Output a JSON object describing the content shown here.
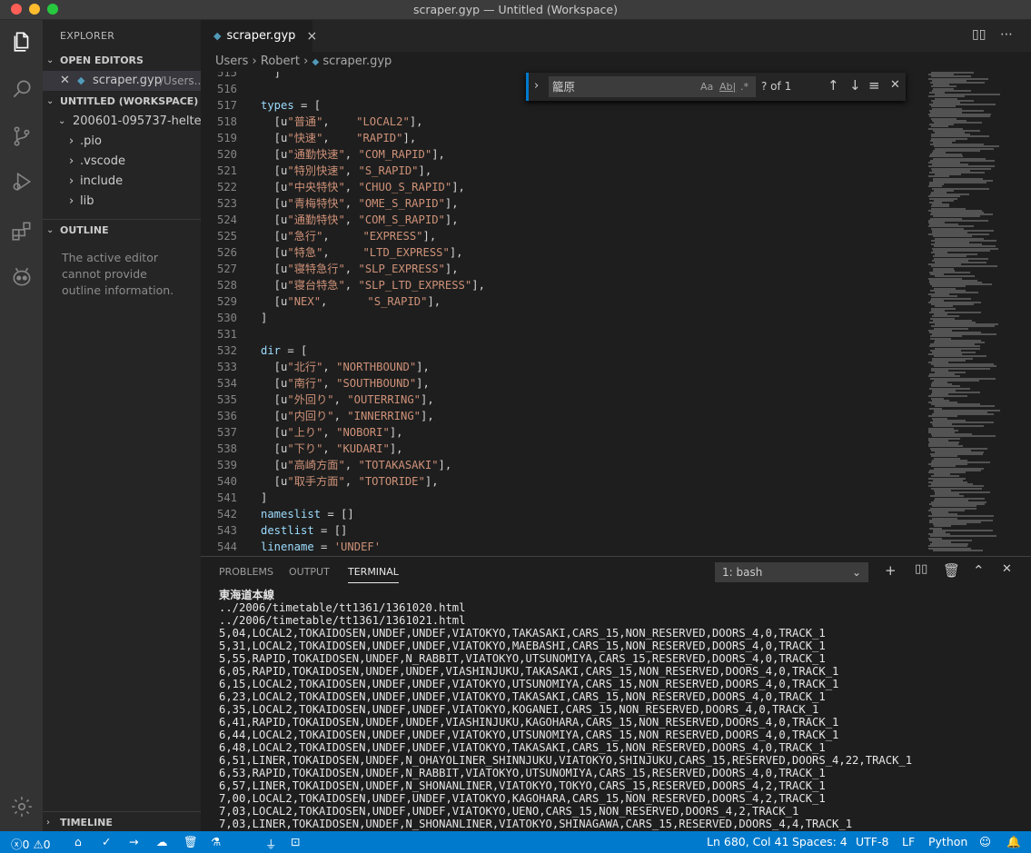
{
  "window": {
    "title": "scraper.gyp — Untitled (Workspace)",
    "traffic": {
      "close": "#ff5f56",
      "minimize": "#ffbd2e",
      "zoom": "#27c93f"
    }
  },
  "activity_bar": {
    "icons": [
      "files-icon",
      "search-icon",
      "source-control-icon",
      "run-debug-icon",
      "extensions-icon",
      "platformio-alien-icon",
      "settings-gear-icon"
    ]
  },
  "sidebar": {
    "title": "EXPLORER",
    "open_editors": {
      "header": "OPEN EDITORS",
      "file_name": "scraper.gyp",
      "file_path": "/Users..."
    },
    "workspace": {
      "header": "UNTITLED (WORKSPACE)",
      "root": "200601-095737-helte...",
      "folders": [
        ".pio",
        ".vscode",
        "include",
        "lib"
      ]
    },
    "outline": {
      "header": "OUTLINE",
      "message": "The active editor cannot provide outline information."
    },
    "timeline": {
      "header": "TIMELINE"
    }
  },
  "editor": {
    "tab": {
      "label": "scraper.gyp",
      "close": "×"
    },
    "breadcrumb": [
      "Users",
      "Robert",
      "scraper.gyp"
    ],
    "find": {
      "query": "籠原",
      "case": "Aa",
      "word": "Ab|",
      "regex": ".*",
      "result": "? of 1"
    },
    "lines": [
      {
        "n": "515",
        "t": "  ]"
      },
      {
        "n": "516",
        "t": ""
      },
      {
        "n": "517",
        "t": "types = ["
      },
      {
        "n": "518",
        "t": "  [u\"普通\",    \"LOCAL2\"],"
      },
      {
        "n": "519",
        "t": "  [u\"快速\",    \"RAPID\"],"
      },
      {
        "n": "520",
        "t": "  [u\"通勤快速\", \"COM_RAPID\"],"
      },
      {
        "n": "521",
        "t": "  [u\"特別快速\", \"S_RAPID\"],"
      },
      {
        "n": "522",
        "t": "  [u\"中央特快\", \"CHUO_S_RAPID\"],"
      },
      {
        "n": "523",
        "t": "  [u\"青梅特快\", \"OME_S_RAPID\"],"
      },
      {
        "n": "524",
        "t": "  [u\"通勤特快\", \"COM_S_RAPID\"],"
      },
      {
        "n": "525",
        "t": "  [u\"急行\",     \"EXPRESS\"],"
      },
      {
        "n": "526",
        "t": "  [u\"特急\",     \"LTD_EXPRESS\"],"
      },
      {
        "n": "527",
        "t": "  [u\"寝特急行\", \"SLP_EXPRESS\"],"
      },
      {
        "n": "528",
        "t": "  [u\"寝台特急\", \"SLP_LTD_EXPRESS\"],"
      },
      {
        "n": "529",
        "t": "  [u\"NEX\",      \"S_RAPID\"],"
      },
      {
        "n": "530",
        "t": "]"
      },
      {
        "n": "531",
        "t": ""
      },
      {
        "n": "532",
        "t": "dir = ["
      },
      {
        "n": "533",
        "t": "  [u\"北行\", \"NORTHBOUND\"],"
      },
      {
        "n": "534",
        "t": "  [u\"南行\", \"SOUTHBOUND\"],"
      },
      {
        "n": "535",
        "t": "  [u\"外回り\", \"OUTERRING\"],"
      },
      {
        "n": "536",
        "t": "  [u\"内回り\", \"INNERRING\"],"
      },
      {
        "n": "537",
        "t": "  [u\"上り\", \"NOBORI\"],"
      },
      {
        "n": "538",
        "t": "  [u\"下り\", \"KUDARI\"],"
      },
      {
        "n": "539",
        "t": "  [u\"高崎方面\", \"TOTAKASAKI\"],"
      },
      {
        "n": "540",
        "t": "  [u\"取手方面\", \"TOTORIDE\"],"
      },
      {
        "n": "541",
        "t": "]"
      },
      {
        "n": "542",
        "t": "nameslist = []"
      },
      {
        "n": "543",
        "t": "destlist = []"
      },
      {
        "n": "544",
        "t": "linename = 'UNDEF'"
      }
    ]
  },
  "panel": {
    "tabs": [
      "PROBLEMS",
      "OUTPUT",
      "TERMINAL"
    ],
    "active_tab": "TERMINAL",
    "terminal_select": "1: bash",
    "terminal_lines": [
      "東海道本線",
      "../2006/timetable/tt1361/1361020.html",
      "../2006/timetable/tt1361/1361021.html",
      "5,04,LOCAL2,TOKAIDOSEN,UNDEF,UNDEF,VIATOKYO,TAKASAKI,CARS_15,NON_RESERVED,DOORS_4,0,TRACK_1",
      "5,31,LOCAL2,TOKAIDOSEN,UNDEF,UNDEF,VIATOKYO,MAEBASHI,CARS_15,NON_RESERVED,DOORS_4,0,TRACK_1",
      "5,55,RAPID,TOKAIDOSEN,UNDEF,N_RABBIT,VIATOKYO,UTSUNOMIYA,CARS_15,RESERVED,DOORS_4,0,TRACK_1",
      "6,05,RAPID,TOKAIDOSEN,UNDEF,UNDEF,VIASHINJUKU,TAKASAKI,CARS_15,NON_RESERVED,DOORS_4,0,TRACK_1",
      "6,15,LOCAL2,TOKAIDOSEN,UNDEF,UNDEF,VIATOKYO,UTSUNOMIYA,CARS_15,NON_RESERVED,DOORS_4,0,TRACK_1",
      "6,23,LOCAL2,TOKAIDOSEN,UNDEF,UNDEF,VIATOKYO,TAKASAKI,CARS_15,NON_RESERVED,DOORS_4,0,TRACK_1",
      "6,35,LOCAL2,TOKAIDOSEN,UNDEF,UNDEF,VIATOKYO,KOGANEI,CARS_15,NON_RESERVED,DOORS_4,0,TRACK_1",
      "6,41,RAPID,TOKAIDOSEN,UNDEF,UNDEF,VIASHINJUKU,KAGOHARA,CARS_15,NON_RESERVED,DOORS_4,0,TRACK_1",
      "6,44,LOCAL2,TOKAIDOSEN,UNDEF,UNDEF,VIATOKYO,UTSUNOMIYA,CARS_15,NON_RESERVED,DOORS_4,0,TRACK_1",
      "6,48,LOCAL2,TOKAIDOSEN,UNDEF,UNDEF,VIATOKYO,TAKASAKI,CARS_15,NON_RESERVED,DOORS_4,0,TRACK_1",
      "6,51,LINER,TOKAIDOSEN,UNDEF,N_OHAYOLINER_SHINNJUKU,VIATOKYO,SHINJUKU,CARS_15,RESERVED,DOORS_4,22,TRACK_1",
      "6,53,RAPID,TOKAIDOSEN,UNDEF,N_RABBIT,VIATOKYO,UTSUNOMIYA,CARS_15,RESERVED,DOORS_4,0,TRACK_1",
      "6,57,LINER,TOKAIDOSEN,UNDEF,N_SHONANLINER,VIATOKYO,TOKYO,CARS_15,RESERVED,DOORS_4,2,TRACK_1",
      "7,00,LOCAL2,TOKAIDOSEN,UNDEF,UNDEF,VIATOKYO,KAGOHARA,CARS_15,NON_RESERVED,DOORS_4,2,TRACK_1",
      "7,03,LOCAL2,TOKAIDOSEN,UNDEF,UNDEF,VIATOKYO,UENO,CARS_15,NON_RESERVED,DOORS_4,2,TRACK_1",
      "7,03,LINER,TOKAIDOSEN,UNDEF,N_SHONANLINER,VIATOKYO,SHINAGAWA,CARS_15,RESERVED,DOORS_4,4,TRACK_1"
    ]
  },
  "status_bar": {
    "errors": "0",
    "warnings": "0",
    "position": "Ln 680, Col 41",
    "spaces": "Spaces: 4",
    "encoding": "UTF-8",
    "eol": "LF",
    "language": "Python"
  },
  "colors": {
    "accent": "#007acc",
    "editor_bg": "#1e1e1e",
    "string": "#ce9178",
    "variable": "#9cdcfe"
  }
}
